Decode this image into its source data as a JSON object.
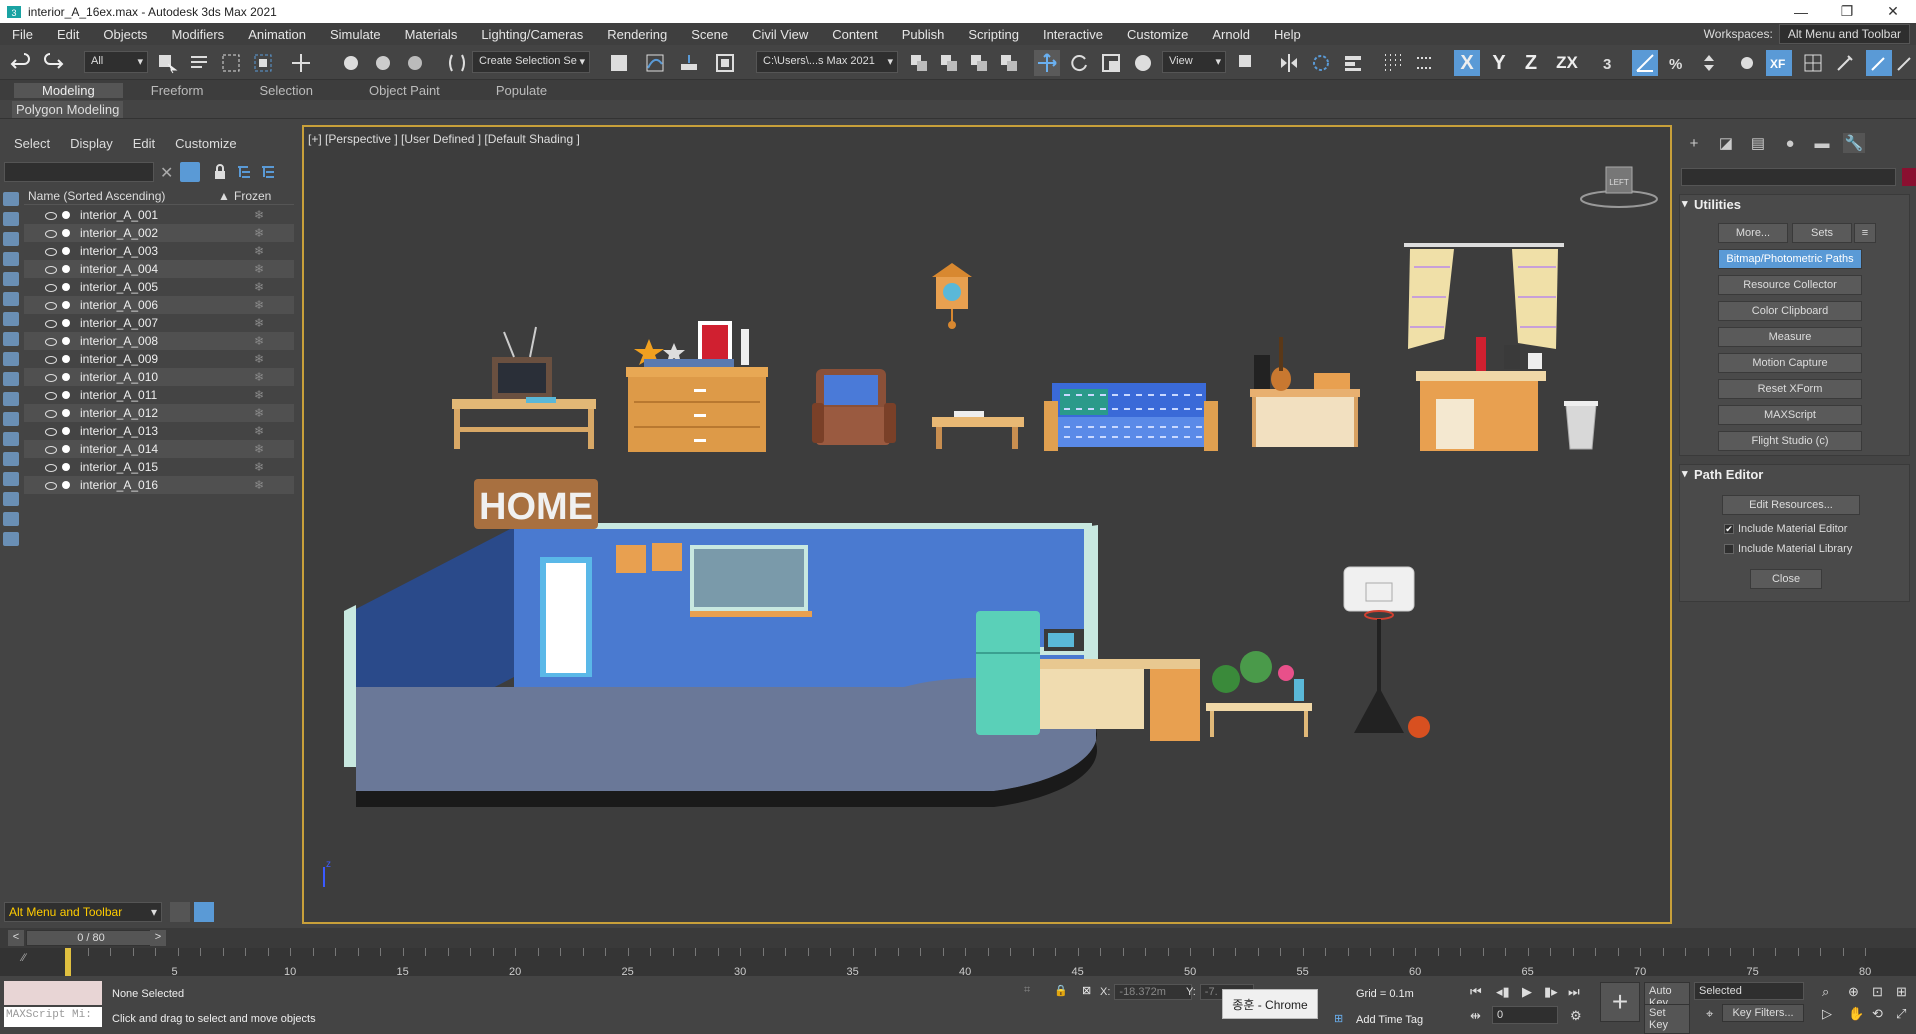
{
  "window": {
    "title": "interior_A_16ex.max - Autodesk 3ds Max 2021",
    "min": "—",
    "max": "❐",
    "close": "✕"
  },
  "menu": [
    "File",
    "Edit",
    "Objects",
    "Modifiers",
    "Animation",
    "Simulate",
    "Materials",
    "Lighting/Cameras",
    "Rendering",
    "Scene",
    "Civil View",
    "Content",
    "Publish",
    "Scripting",
    "Interactive",
    "Customize",
    "Arnold",
    "Help"
  ],
  "workspace": {
    "label": "Workspaces:",
    "value": "Alt Menu and Toolbar"
  },
  "toolbar": {
    "filter": "All",
    "selection_set": "Create Selection Se",
    "path": "C:\\Users\\...s Max 2021",
    "view": "View",
    "axes": [
      "X",
      "Y",
      "Z",
      "ZX"
    ]
  },
  "ribbon": {
    "tabs": [
      "Modeling",
      "Freeform",
      "Selection",
      "Object Paint",
      "Populate"
    ],
    "active": "Modeling",
    "sub": "Polygon Modeling"
  },
  "scene_explorer": {
    "menu": [
      "Select",
      "Display",
      "Edit",
      "Customize"
    ],
    "col_name": "Name (Sorted Ascending)",
    "col_sort": "▲",
    "col_frozen": "Frozen",
    "clear": "✕",
    "frozen_icon": "❄",
    "items": [
      "interior_A_001",
      "interior_A_002",
      "interior_A_003",
      "interior_A_004",
      "interior_A_005",
      "interior_A_006",
      "interior_A_007",
      "interior_A_008",
      "interior_A_009",
      "interior_A_010",
      "interior_A_011",
      "interior_A_012",
      "interior_A_013",
      "interior_A_014",
      "interior_A_015",
      "interior_A_016"
    ],
    "workspace_dd": "Alt Menu and Toolbar"
  },
  "viewport": {
    "label": "[+] [Perspective ] [User Defined ] [Default Shading ]",
    "sign": "HOME",
    "cube": "LEFT",
    "axis_z": "z"
  },
  "command_panel": {
    "utilities": {
      "title": "Utilities",
      "more": "More...",
      "sets": "Sets",
      "buttons": [
        "Bitmap/Photometric Paths",
        "Resource Collector",
        "Color Clipboard",
        "Measure",
        "Motion Capture",
        "Reset XForm",
        "MAXScript",
        "Flight Studio (c)"
      ],
      "active": "Bitmap/Photometric Paths"
    },
    "path_editor": {
      "title": "Path Editor",
      "edit": "Edit Resources...",
      "check1": "Include Material Editor",
      "check1_on": "✔",
      "check2": "Include Material Library",
      "close": "Close"
    }
  },
  "timeline": {
    "position": "0 / 80",
    "prev": "<",
    "next": ">",
    "ticks": [
      "5",
      "10",
      "15",
      "20",
      "25",
      "30",
      "35",
      "40",
      "45",
      "50",
      "55",
      "60",
      "65",
      "70",
      "75",
      "80"
    ]
  },
  "status": {
    "selected": "None Selected",
    "hint": "Click and drag to select and move objects",
    "maxscript": "MAXScript Mi:",
    "x_label": "X:",
    "x": "-18.372m",
    "y_label": "Y:",
    "y": "-7.",
    "grid": "Grid = 0.1m",
    "add_time_tag": "Add Time Tag",
    "auto_key": "Auto Key",
    "set_key": "Set Key",
    "selected_dd": "Selected",
    "key_filters": "Key Filters...",
    "frame": "0",
    "tooltip": "종훈 - Chrome"
  },
  "colors": {
    "accent": "#5a9ad6",
    "viewport_border": "#c8a03a",
    "bg": "#444444"
  }
}
